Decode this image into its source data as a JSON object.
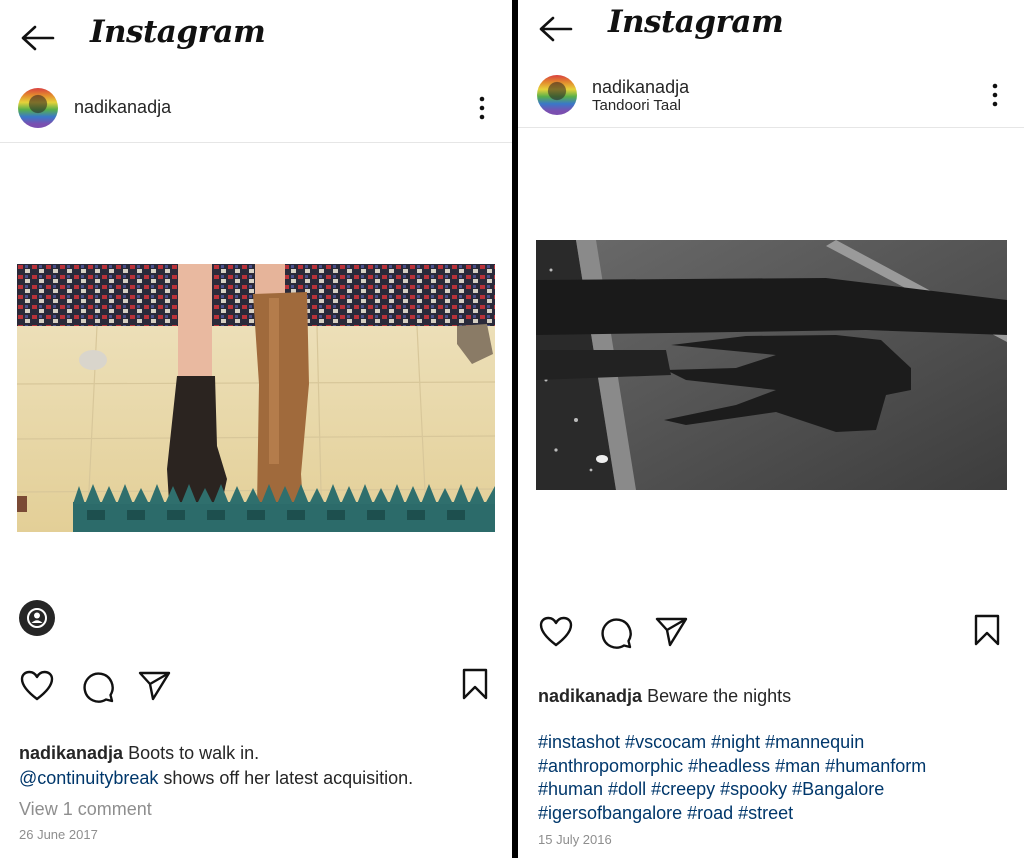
{
  "left": {
    "app_title": "Instagram",
    "username": "nadikanadja",
    "caption_text": "Boots to walk in.",
    "mention": "@continuitybreak",
    "caption_text2": "shows off her latest acquisition.",
    "view_comments": "View 1 comment",
    "date": "26 June 2017",
    "photo_description": "boots-on-rug-photo"
  },
  "right": {
    "app_title": "Instagram",
    "username": "nadikanadja",
    "location": "Tandoori Taal",
    "caption_text": "Beware the nights",
    "hashtags": "#instashot #vscocam #night #mannequin #anthropomorphic #headless #man #humanform #human #doll #creepy #spooky #Bangalore #igersofbangalore #road #street",
    "date": "15 July 2016",
    "photo_description": "shadow-on-road-photo"
  },
  "colors": {
    "link": "#00376b",
    "text": "#262626",
    "muted": "#8e8e8e"
  },
  "icons": [
    "back-arrow-icon",
    "more-options-icon",
    "heart-icon",
    "comment-icon",
    "share-icon",
    "bookmark-icon",
    "user-tag-icon"
  ]
}
